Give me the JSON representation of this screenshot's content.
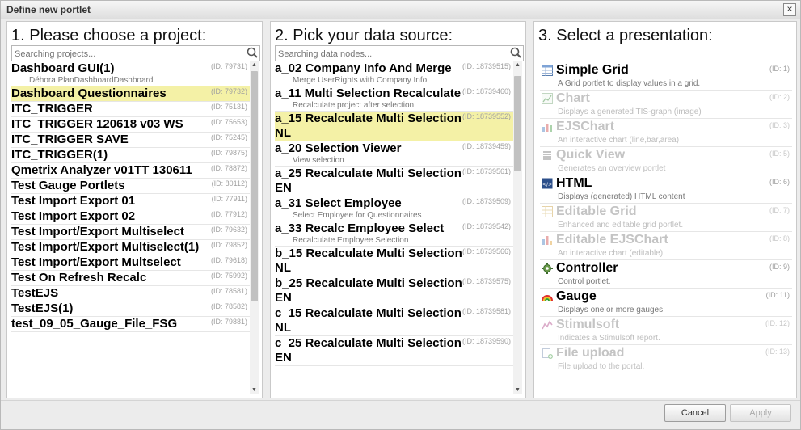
{
  "dialog": {
    "title": "Define new portlet",
    "close_label": "×"
  },
  "projects": {
    "heading": "1. Please choose a project:",
    "search_placeholder": "Searching projects...",
    "scroll_position": 0.15,
    "items": [
      {
        "name": "Dashboard GUI(1)",
        "id": "(ID: 79731)",
        "sub": "Déhora PlanDashboardDashboard"
      },
      {
        "name": "Dashboard Questionnaires",
        "id": "(ID: 79732)",
        "selected": true
      },
      {
        "name": "ITC_TRIGGER",
        "id": "(ID: 75131)"
      },
      {
        "name": "ITC_TRIGGER 120618 v03 WS",
        "id": "(ID: 75653)"
      },
      {
        "name": "ITC_TRIGGER SAVE",
        "id": "(ID: 75245)"
      },
      {
        "name": "ITC_TRIGGER(1)",
        "id": "(ID: 79875)"
      },
      {
        "name": "Qmetrix Analyzer v01TT 130611",
        "id": "(ID: 78872)"
      },
      {
        "name": "Test Gauge Portlets",
        "id": "(ID: 80112)"
      },
      {
        "name": "Test Import Export 01",
        "id": "(ID: 77911)"
      },
      {
        "name": "Test Import Export 02",
        "id": "(ID: 77912)"
      },
      {
        "name": "Test Import/Export Multiselect",
        "id": "(ID: 79632)"
      },
      {
        "name": "Test Import/Export Multiselect(1)",
        "id": "(ID: 79852)"
      },
      {
        "name": "Test Import/Export Multselect",
        "id": "(ID: 79618)"
      },
      {
        "name": "Test On Refresh Recalc",
        "id": "(ID: 75992)"
      },
      {
        "name": "TestEJS",
        "id": "(ID: 78581)"
      },
      {
        "name": "TestEJS(1)",
        "id": "(ID: 78582)"
      },
      {
        "name": "test_09_05_Gauge_File_FSG",
        "id": "(ID: 79881)"
      }
    ]
  },
  "datasource": {
    "heading": "2. Pick your data source:",
    "search_placeholder": "Searching data nodes...",
    "scroll_position": 0.05,
    "items": [
      {
        "name": "a_02 Company Info And Merge",
        "id": "(ID: 18739515)",
        "sub": "Merge UserRights with Company Info"
      },
      {
        "name": "a_11 Multi Selection Recalculate",
        "id": "(ID: 18739460)",
        "sub": "Recalculate project after selection"
      },
      {
        "name": "a_15 Recalculate Multi Selection NL",
        "id": "(ID: 18739552)",
        "selected": true
      },
      {
        "name": "a_20 Selection Viewer",
        "id": "(ID: 18739459)",
        "sub": "View selection"
      },
      {
        "name": "a_25 Recalculate Multi Selection EN",
        "id": "(ID: 18739561)"
      },
      {
        "name": "a_31 Select Employee",
        "id": "(ID: 18739509)",
        "sub": "Select Employee for Questionnaires"
      },
      {
        "name": "a_33 Recalc Employee Select",
        "id": "(ID: 18739542)",
        "sub": "Recalculate Employee Selection"
      },
      {
        "name": "b_15 Recalculate Multi Selection NL",
        "id": "(ID: 18739566)"
      },
      {
        "name": "b_25 Recalculate Multi Selection EN",
        "id": "(ID: 18739575)"
      },
      {
        "name": "c_15 Recalculate Multi Selection NL",
        "id": "(ID: 18739581)"
      },
      {
        "name": "c_25 Recalculate Multi Selection EN",
        "id": "(ID: 18739590)"
      }
    ]
  },
  "presentation": {
    "heading": "3. Select a presentation:",
    "items": [
      {
        "name": "Simple Grid",
        "id": "(ID: 1)",
        "desc": "A Grid portlet to display values in a grid.",
        "enabled": true,
        "icon": "grid-icon"
      },
      {
        "name": "Chart",
        "id": "(ID: 2)",
        "desc": "Displays a generated TIS-graph (image)",
        "enabled": false,
        "icon": "chart-icon"
      },
      {
        "name": "EJSChart",
        "id": "(ID: 3)",
        "desc": "An interactive chart (line,bar,area)",
        "enabled": false,
        "icon": "bar-chart-icon"
      },
      {
        "name": "Quick View",
        "id": "(ID: 5)",
        "desc": "Generates an overview portlet",
        "enabled": false,
        "icon": "list-icon"
      },
      {
        "name": "HTML",
        "id": "(ID: 6)",
        "desc": "Displays (generated) HTML content",
        "enabled": true,
        "icon": "html-icon"
      },
      {
        "name": "Editable Grid",
        "id": "(ID: 7)",
        "desc": "Enhanced and editable grid portlet.",
        "enabled": false,
        "icon": "editable-grid-icon"
      },
      {
        "name": "Editable EJSChart",
        "id": "(ID: 8)",
        "desc": "An interactive chart (editable).",
        "enabled": false,
        "icon": "editable-chart-icon"
      },
      {
        "name": "Controller",
        "id": "(ID: 9)",
        "desc": "Control portlet.",
        "enabled": true,
        "icon": "gear-icon"
      },
      {
        "name": "Gauge",
        "id": "(ID: 11)",
        "desc": "Displays one or more gauges.",
        "enabled": true,
        "icon": "gauge-icon"
      },
      {
        "name": "Stimulsoft",
        "id": "(ID: 12)",
        "desc": "Indicates a Stimulsoft report.",
        "enabled": false,
        "icon": "report-icon"
      },
      {
        "name": "File upload",
        "id": "(ID: 13)",
        "desc": "File upload to the portal.",
        "enabled": false,
        "icon": "upload-icon"
      }
    ]
  },
  "footer": {
    "cancel_label": "Cancel",
    "apply_label": "Apply"
  }
}
